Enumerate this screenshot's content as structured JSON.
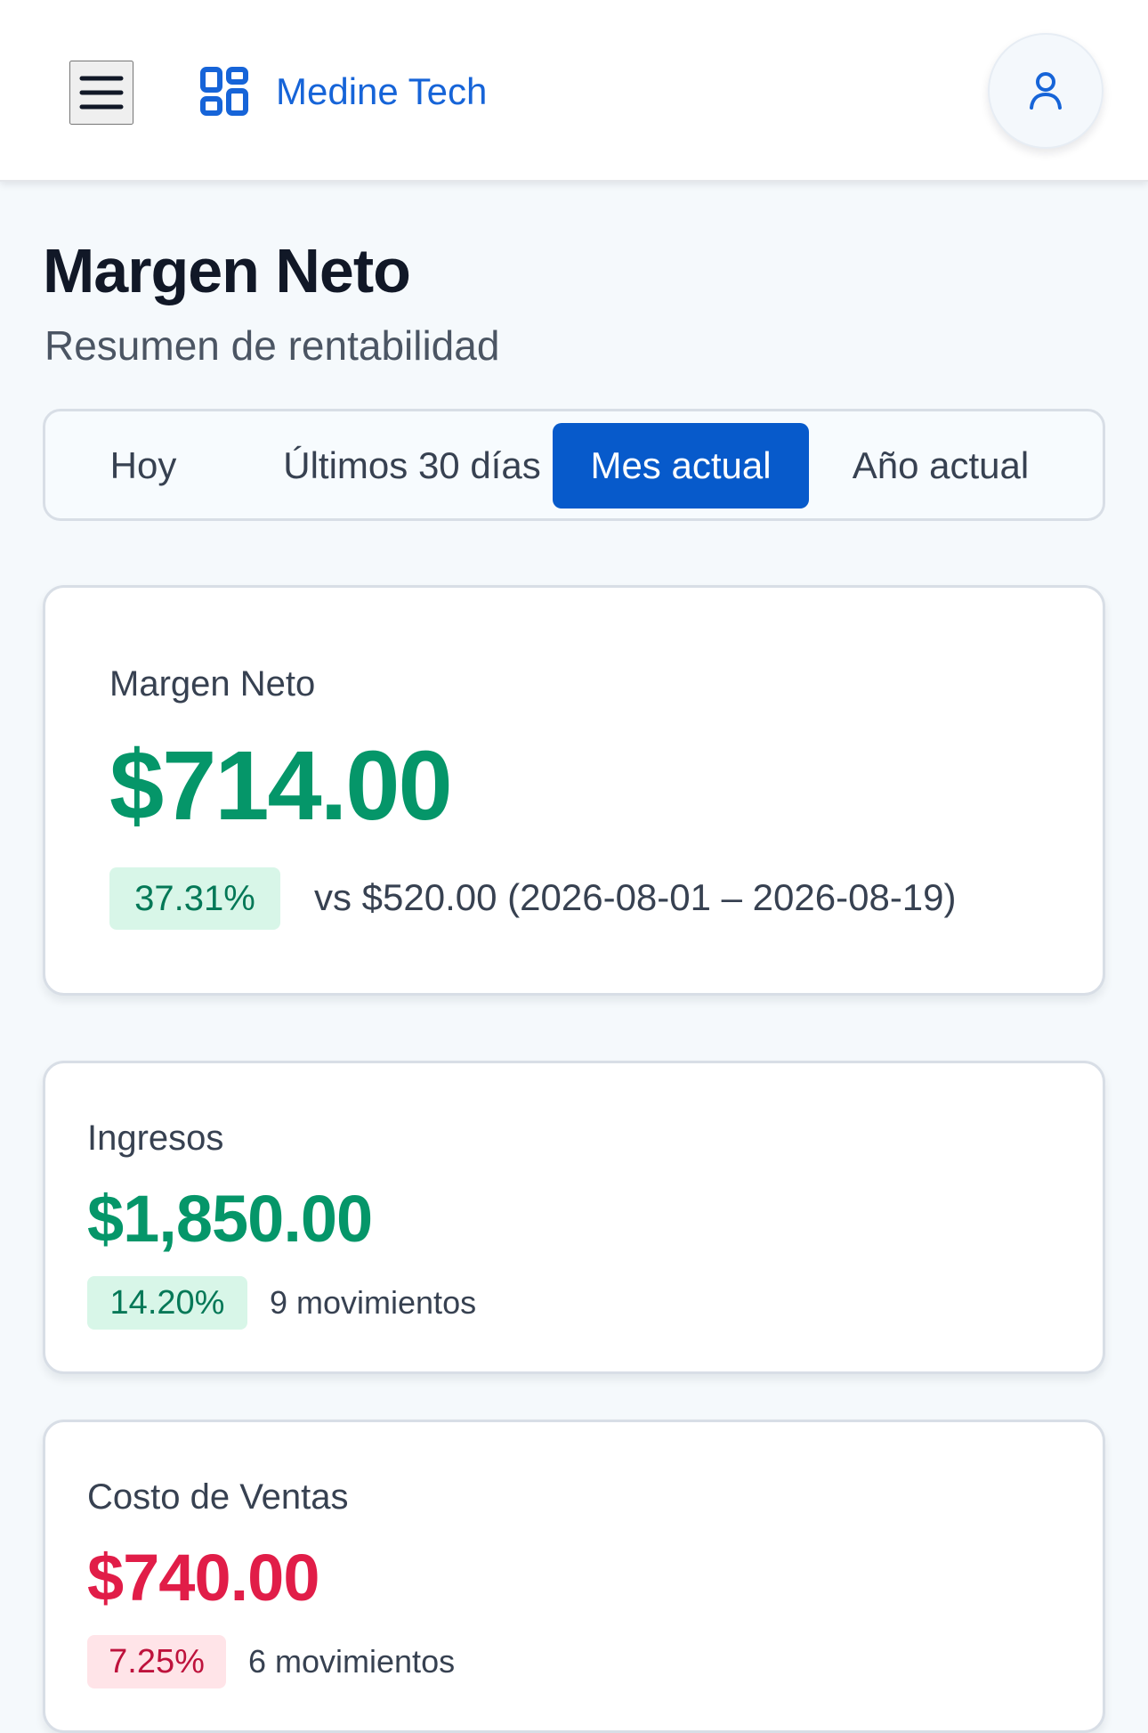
{
  "header": {
    "brand_name": "Medine Tech",
    "menu_icon": "menu-icon",
    "brand_icon": "dashboard-icon",
    "user_icon": "user-icon",
    "colors": {
      "brand": "#1664d8",
      "header_background": "#ffffff"
    }
  },
  "page": {
    "title": "Margen Neto",
    "subtitle": "Resumen de rentabilidad"
  },
  "period_tabs": [
    {
      "label": "Hoy",
      "selected": false
    },
    {
      "label": "Últimos 30 días",
      "selected": false
    },
    {
      "label": "Mes actual",
      "selected": true
    },
    {
      "label": "Año actual",
      "selected": false
    }
  ],
  "summary_card": {
    "label": "Margen Neto",
    "value": "$714.00",
    "percentage": "37.31%",
    "comparison": "vs $520.00 (2026-08-01 – 2026-08-19)",
    "value_color": "#059669",
    "badge_color": "#d8f6e8"
  },
  "metrics": [
    {
      "label": "Ingresos",
      "value": "$1,850.00",
      "percentage": "14.20%",
      "movements": "9 movimientos",
      "value_color": "#059669",
      "badge_color": "#d8f6e8"
    },
    {
      "label": "Costo de Ventas",
      "value": "$740.00",
      "percentage": "7.25%",
      "movements": "6 movimientos",
      "value_color": "#e11d48",
      "badge_color": "#ffe4e8"
    }
  ],
  "colors": {
    "accent": "#075acb",
    "positive": "#059669",
    "negative": "#e11d48",
    "background": "#f5f9fc"
  }
}
